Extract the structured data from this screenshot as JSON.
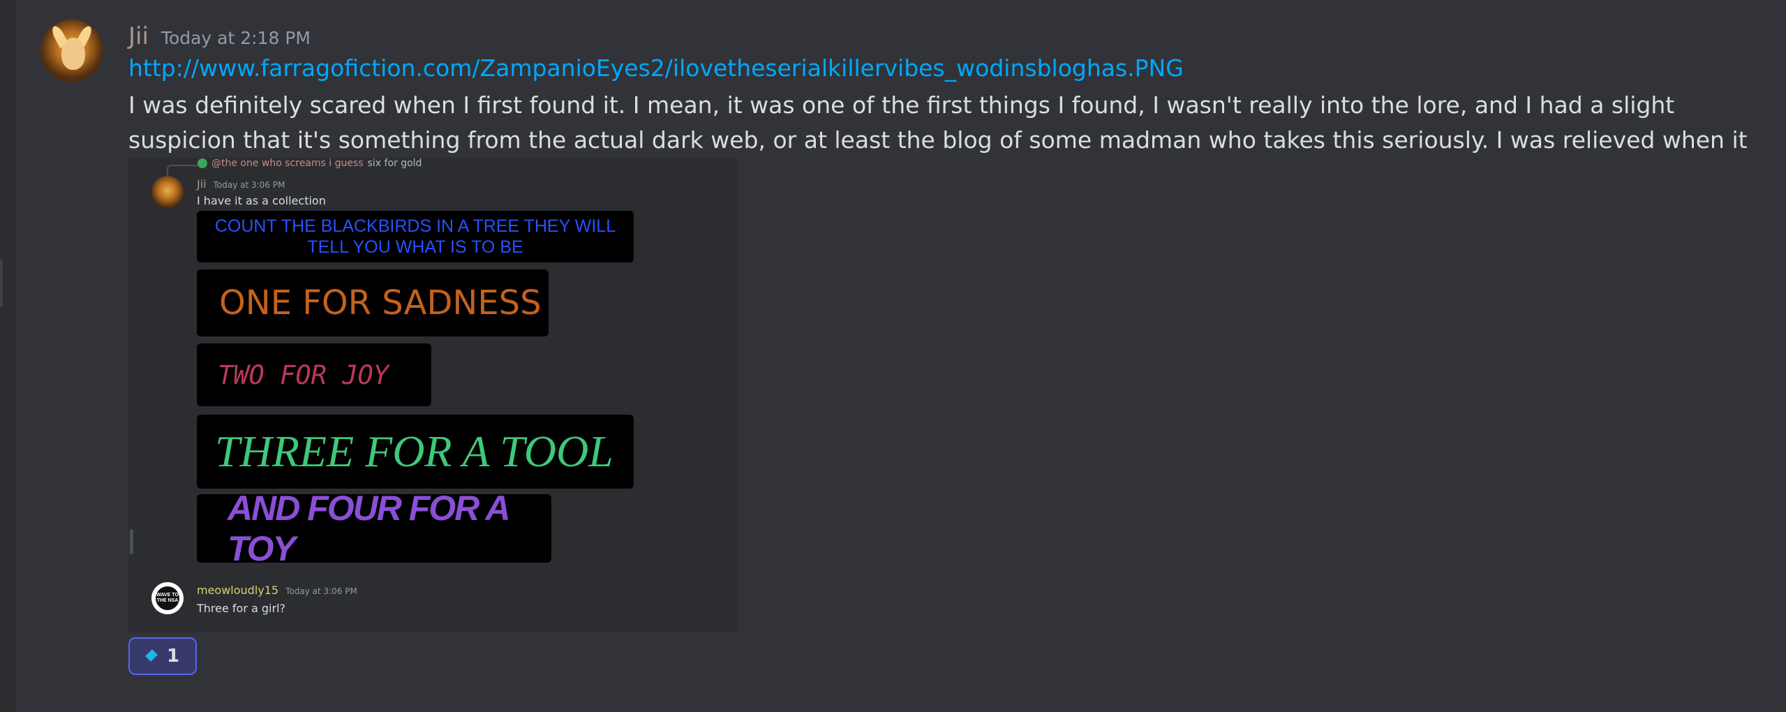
{
  "message": {
    "author": "Jii",
    "timestamp": "Today at 2:18 PM",
    "link": "http://www.farragofiction.com/ZampanioEyes2/ilovetheserialkillervibes_wodinsbloghas.PNG",
    "text": "I was definitely scared when I first found it. I mean, it was one of the first things I found, I wasn't really into the lore, and I had a slight suspicion that it's something from the actual dark web, or at least the blog of some madman who takes this seriously. I was relieved when it was mentioned in the East."
  },
  "embed": {
    "reply": {
      "mention": "@the one who screams i guess",
      "text": "six for gold"
    },
    "jii": {
      "author": "Jii",
      "timestamp": "Today at 3:06 PM",
      "text": "I have it as a collection"
    },
    "tiles": [
      "COUNT THE BLACKBIRDS IN A TREE THEY WILL TELL YOU WHAT IS TO BE",
      "ONE FOR SADNESS",
      "TWO FOR JOY",
      "THREE FOR A TOOL",
      "AND FOUR FOR A TOY"
    ],
    "meow": {
      "author": "meowloudly15",
      "timestamp": "Today at 3:06 PM",
      "text": "Three for a girl?",
      "avatar_text": "WAVE TO THE NSA"
    }
  },
  "reaction": {
    "icon": "diamond-icon",
    "count": "1"
  },
  "colors": {
    "background": "#313338",
    "link": "#00a8fc",
    "reaction_border": "#5865f2"
  }
}
